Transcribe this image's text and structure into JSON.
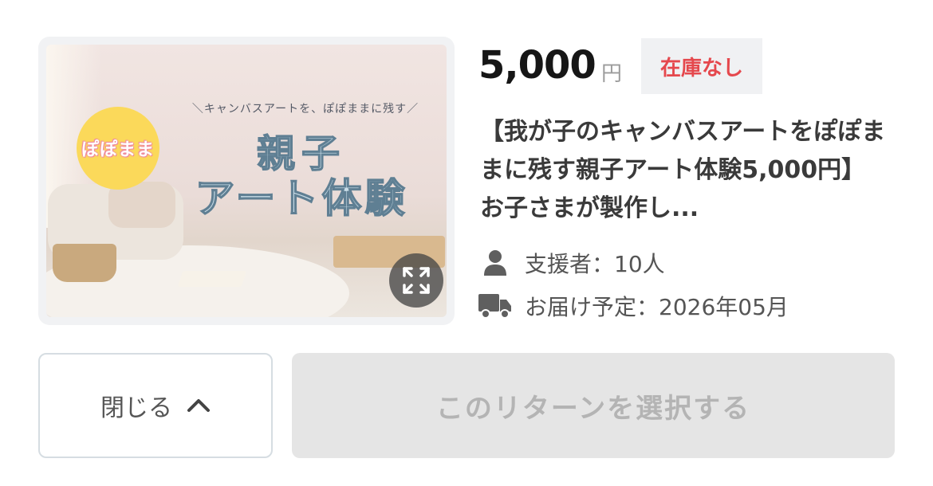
{
  "reward": {
    "price": "5,000",
    "currency": "円",
    "stock_status": "在庫なし",
    "title": "【我が子のキャンバスアートをぽぽままに残す親子アート体験5,000円】 お子さまが製作し...",
    "supporters_label": "支援者：10人",
    "delivery_label": "お届け予定：2026年05月"
  },
  "thumbnail": {
    "brand_badge": "ぽぽまま",
    "subtitle": "＼キャンバスアートを、ぽぽままに残す／",
    "title_line1": "親子",
    "title_line2": "アート体験",
    "expand_icon": "expand-icon"
  },
  "actions": {
    "close_label": "閉じる",
    "close_icon": "chevron-up-icon",
    "select_label": "このリターンを選択する"
  },
  "colors": {
    "stock_text": "#e5484d",
    "badge_bg": "#fbd95a",
    "disabled_bg": "#e5e5e5",
    "disabled_text": "#b4b4b4"
  }
}
